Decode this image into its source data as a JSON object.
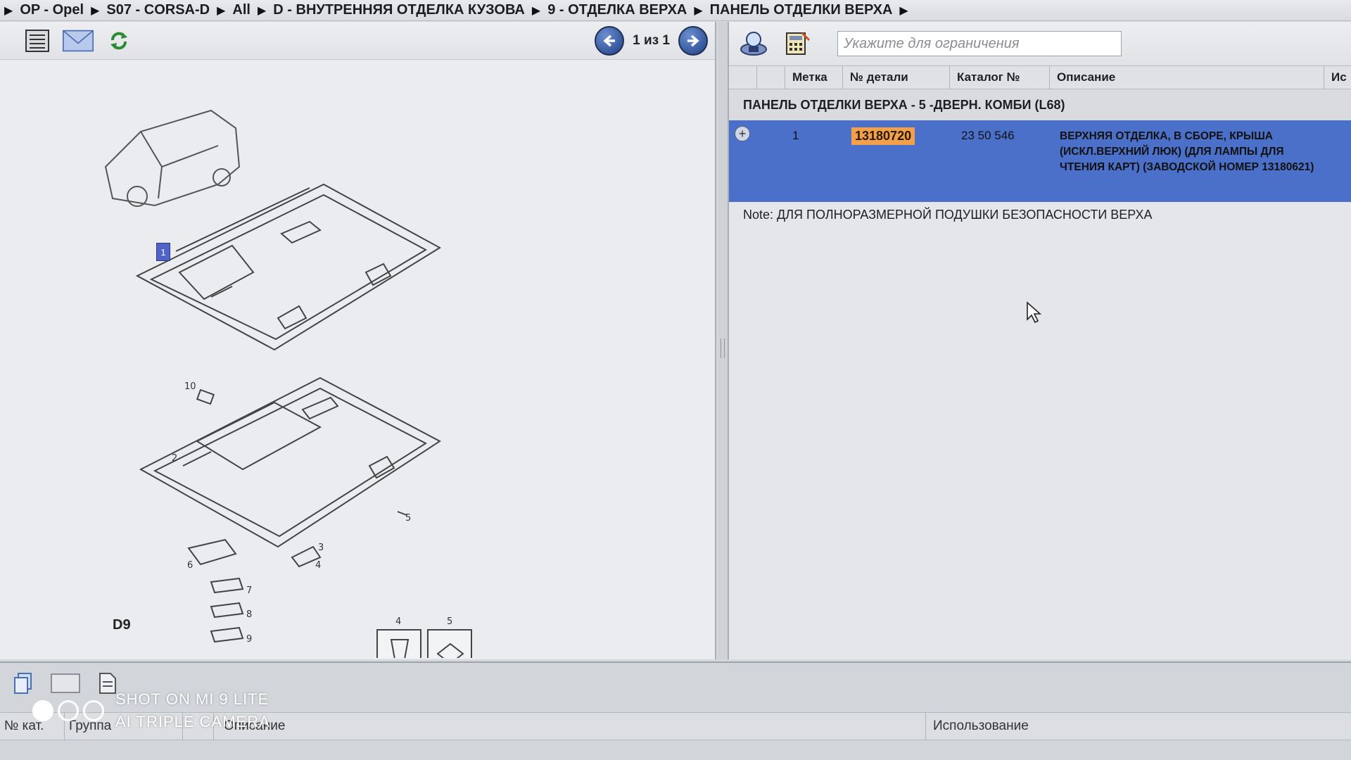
{
  "breadcrumb": [
    "OP - Opel",
    "S07 - CORSA-D",
    "All",
    "D - ВНУТРЕННЯЯ ОТДЕЛКА КУЗОВА",
    "9 - ОТДЕЛКА ВЕРХА",
    "ПАНЕЛЬ ОТДЕЛКИ ВЕРХА"
  ],
  "left_toolbar": {
    "pager_text": "1 из 1",
    "icons": [
      "list-icon",
      "mail-icon",
      "refresh-icon"
    ]
  },
  "diagram": {
    "label": "D9",
    "callout_selected": "1",
    "part_numbers": [
      "10",
      "2",
      "5",
      "3",
      "6",
      "4",
      "7",
      "8",
      "9",
      "4",
      "5"
    ]
  },
  "right_toolbar": {
    "search_placeholder": "Укажите для ограничения",
    "icons": [
      "car-lookup-icon",
      "calculator-icon"
    ]
  },
  "table": {
    "columns": [
      "",
      "",
      "Метка",
      "№ детали",
      "Каталог №",
      "Описание",
      "Ис"
    ],
    "group_title": "ПАНЕЛЬ ОТДЕЛКИ ВЕРХА - 5 -ДВЕРН. КОМБИ (L68)",
    "rows": [
      {
        "mark": "1",
        "part_no": "13180720",
        "catalog_no": "23 50 546",
        "description": "ВЕРХНЯЯ ОТДЕЛКА, В СБОРЕ, КРЫША (ИСКЛ.ВЕРХНИЙ ЛЮК) (ДЛЯ ЛАМПЫ ДЛЯ ЧТЕНИЯ КАРТ) (ЗАВОДСКОЙ НОМЕР 13180621)"
      }
    ],
    "note": "Note: ДЛЯ ПОЛНОРАЗМЕРНОЙ ПОДУШКИ БЕЗОПАСНОСТИ ВЕРХА"
  },
  "bottom": {
    "columns": [
      "№ кат.",
      "Группа",
      "",
      "Описание",
      "Использование"
    ]
  },
  "watermark": {
    "line1": "SHOT ON MI 9 LITE",
    "line2": "AI TRIPLE CAMERA"
  },
  "colors": {
    "selection": "#4b70c9",
    "part_highlight": "#f2a14a",
    "nav_button": "#1e3e86"
  }
}
